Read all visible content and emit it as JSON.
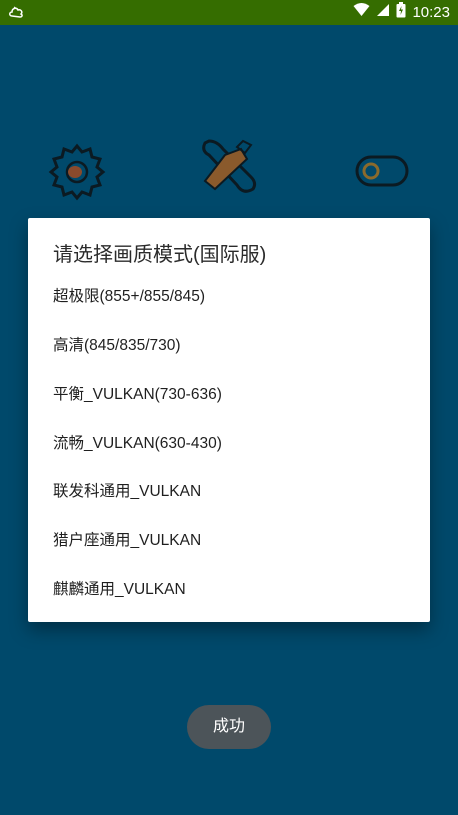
{
  "status_bar": {
    "time": "10:23",
    "left_icon": "cloud-icon",
    "icons": [
      "wifi-icon",
      "signal-icon",
      "battery-icon"
    ]
  },
  "background_icons": [
    "settings-gear-icon",
    "wrench-tools-icon",
    "toggle-switch-icon"
  ],
  "dialog": {
    "title": "请选择画质模式(国际服)",
    "options": [
      {
        "label": "超极限(855+/855/845)"
      },
      {
        "label": "高清(845/835/730)"
      },
      {
        "label": "平衡_VULKAN(730-636)"
      },
      {
        "label": "流畅_VULKAN(630-430)"
      },
      {
        "label": "联发科通用_VULKAN"
      },
      {
        "label": "猎户座通用_VULKAN"
      },
      {
        "label": "麒麟通用_VULKAN"
      }
    ]
  },
  "toast": {
    "text": "成功"
  },
  "colors": {
    "status_bar": "#356d00",
    "background": "#00496b",
    "dialog": "#ffffff",
    "toast": "#4c5459"
  }
}
